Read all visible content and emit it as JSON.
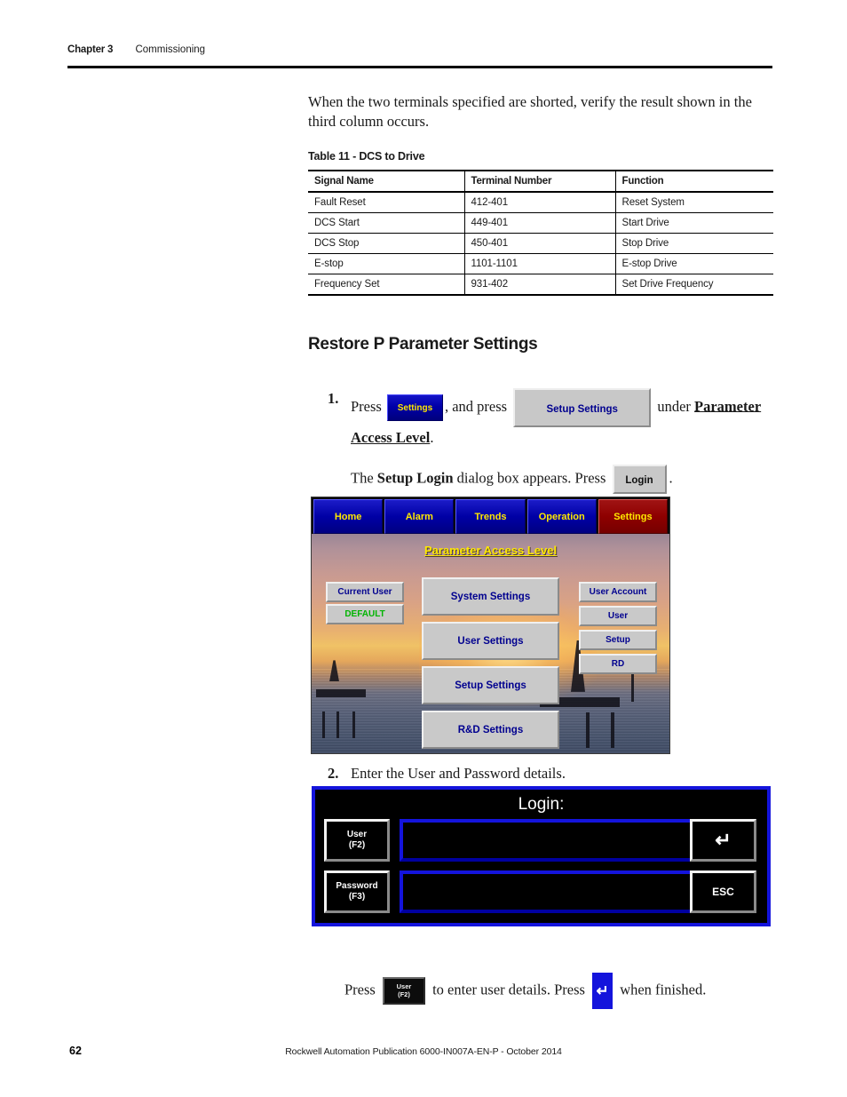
{
  "header": {
    "chapter": "Chapter 3",
    "chapter_title": "Commissioning"
  },
  "intro_paragraph": "When the two terminals specified are shorted, verify the result shown in the third column occurs.",
  "table": {
    "caption": "Table 11 - DCS to Drive",
    "columns": [
      "Signal Name",
      "Terminal Number",
      "Function"
    ],
    "rows": [
      [
        "Fault Reset",
        "412-401",
        "Reset System"
      ],
      [
        "DCS Start",
        "449-401",
        "Start Drive"
      ],
      [
        "DCS Stop",
        "450-401",
        "Stop Drive"
      ],
      [
        "E-stop",
        "1101-1101",
        "E-stop Drive"
      ],
      [
        "Frequency Set",
        "931-402",
        "Set Drive Frequency"
      ]
    ]
  },
  "section": {
    "heading": "Restore P Parameter Settings"
  },
  "steps": {
    "one": {
      "number": "1.",
      "text_a": "Press",
      "chip_settings": "Settings",
      "text_b": ", and press",
      "chip_setup_settings": "Setup Settings",
      "text_c": "under",
      "emphasis": "Parameter Access Level",
      "text_d": "."
    },
    "one_sub": {
      "text_a": "The",
      "emphasis": "Setup Login",
      "text_b": "dialog box appears. Press",
      "chip_login": "Login",
      "text_c": "."
    },
    "two": {
      "number": "2.",
      "text": "Enter the User and Password details."
    }
  },
  "hmi": {
    "nav_tabs": [
      {
        "label": "Home",
        "active": false
      },
      {
        "label": "Alarm",
        "active": false
      },
      {
        "label": "Trends",
        "active": false
      },
      {
        "label": "Operation",
        "active": false
      },
      {
        "label": "Settings",
        "active": true
      }
    ],
    "screen_title": "Parameter Access Level",
    "left_column": [
      {
        "label": "Current User"
      },
      {
        "label": "DEFAULT"
      }
    ],
    "center_column": [
      {
        "label": "System Settings"
      },
      {
        "label": "User Settings"
      },
      {
        "label": "Setup Settings"
      },
      {
        "label": "R&D Settings"
      }
    ],
    "right_column": [
      {
        "label": "User Account"
      },
      {
        "label": "User"
      },
      {
        "label": "Setup"
      },
      {
        "label": "RD"
      }
    ],
    "colors": {
      "tab_bg": "#0000a5",
      "tab_text": "#ffe800",
      "tab_active_bg": "#8e0000",
      "button_bg": "#c9c9c9",
      "button_text": "#00008f",
      "default_text": "#00b400"
    }
  },
  "login_dialog": {
    "title": "Login:",
    "user_key_line1": "User",
    "user_key_line2": "(F2)",
    "password_key_line1": "Password",
    "password_key_line2": "(F3)",
    "user_value": "",
    "password_value": "",
    "enter_key": "↵",
    "esc_key": "ESC",
    "colors": {
      "border": "#1414dc",
      "background": "#000000"
    }
  },
  "final_paragraph": {
    "text_a": "Press",
    "chip_user_line1": "User",
    "chip_user_line2": "(F2)",
    "text_b": "to enter user details. Press",
    "chip_enter": "↵",
    "text_c": "when finished."
  },
  "footer": {
    "page_number": "62",
    "publication": "Rockwell Automation Publication 6000-IN007A-EN-P - October 2014"
  }
}
